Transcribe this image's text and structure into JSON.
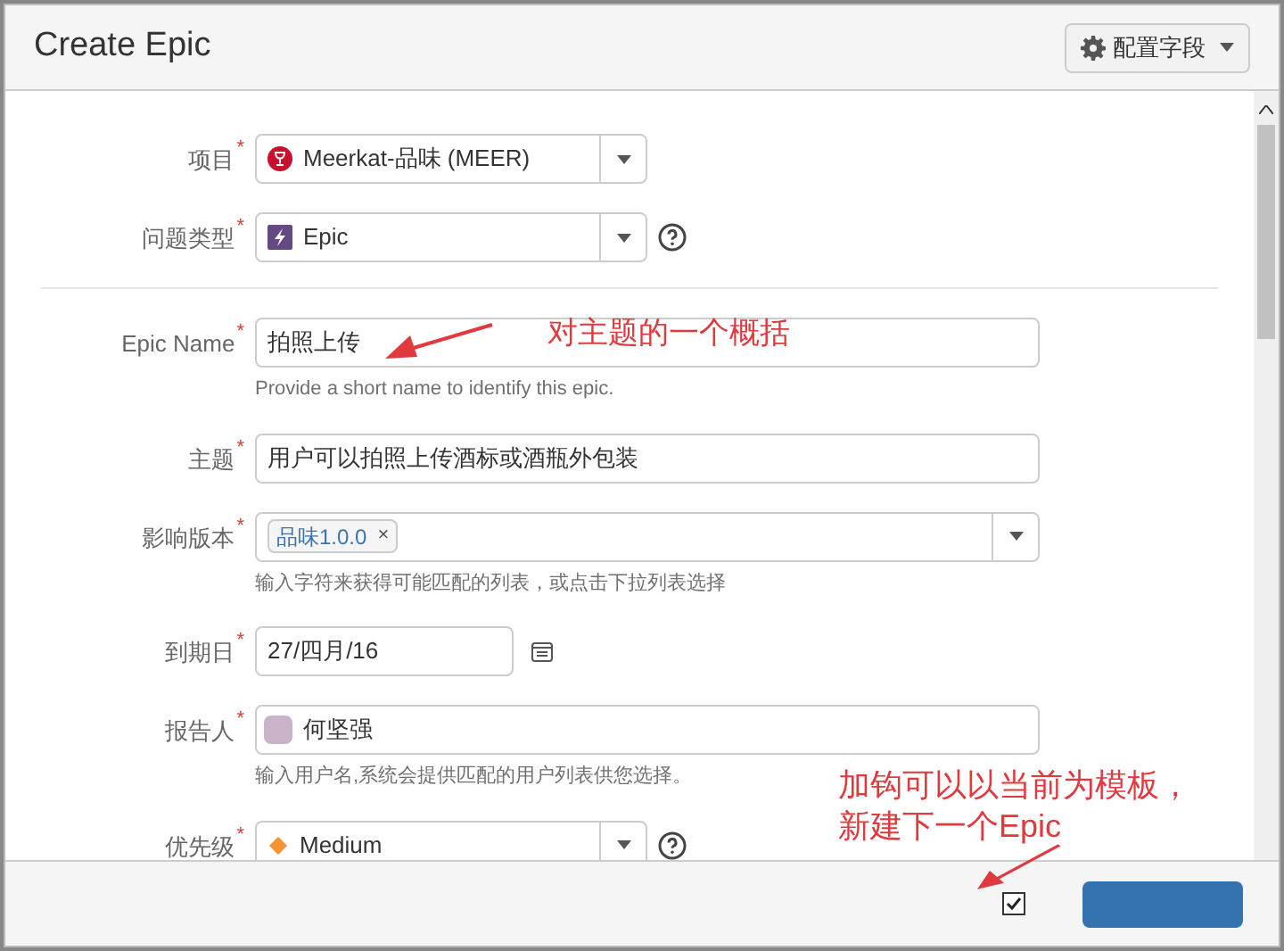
{
  "dialog": {
    "title": "Create Epic",
    "config_button": "配置字段"
  },
  "fields": [
    {
      "kind": "project",
      "label": "项目",
      "required_mark": "*",
      "value": "Meerkat-品味 (MEER)",
      "help": false
    },
    {
      "kind": "issue_type",
      "label": "问题类型",
      "required_mark": "*",
      "value": "Epic",
      "help": true
    },
    {
      "kind": "divider"
    },
    {
      "kind": "text",
      "label": "Epic Name",
      "required_mark": "*",
      "value": "拍照上传",
      "hint": "Provide a short name to identify this epic."
    },
    {
      "kind": "text",
      "label": "主题",
      "required_mark": "*",
      "value": "用户可以拍照上传酒标或酒瓶外包装"
    },
    {
      "kind": "versions",
      "label": "影响版本",
      "required_mark": "*",
      "tags": [
        "品味1.0.0"
      ],
      "tag_remove": "×",
      "hint": "输入字符来获得可能匹配的列表，或点击下拉列表选择"
    },
    {
      "kind": "date",
      "label": "到期日",
      "required_mark": "*",
      "value": "27/四月/16"
    },
    {
      "kind": "user",
      "label": "报告人",
      "required_mark": "*",
      "value": "何坚强",
      "hint": "输入用户名,系统会提供匹配的用户列表供您选择。"
    },
    {
      "kind": "priority",
      "label": "优先级",
      "required_mark": "*",
      "value": "Medium",
      "help": true
    }
  ],
  "annotations": [
    {
      "lines": [
        "对主题的一个概括"
      ]
    },
    {
      "lines": [
        "加钩可以以当前为模板，",
        "新建下一个Epic"
      ]
    }
  ],
  "footer": {
    "create_another_checked": true
  }
}
